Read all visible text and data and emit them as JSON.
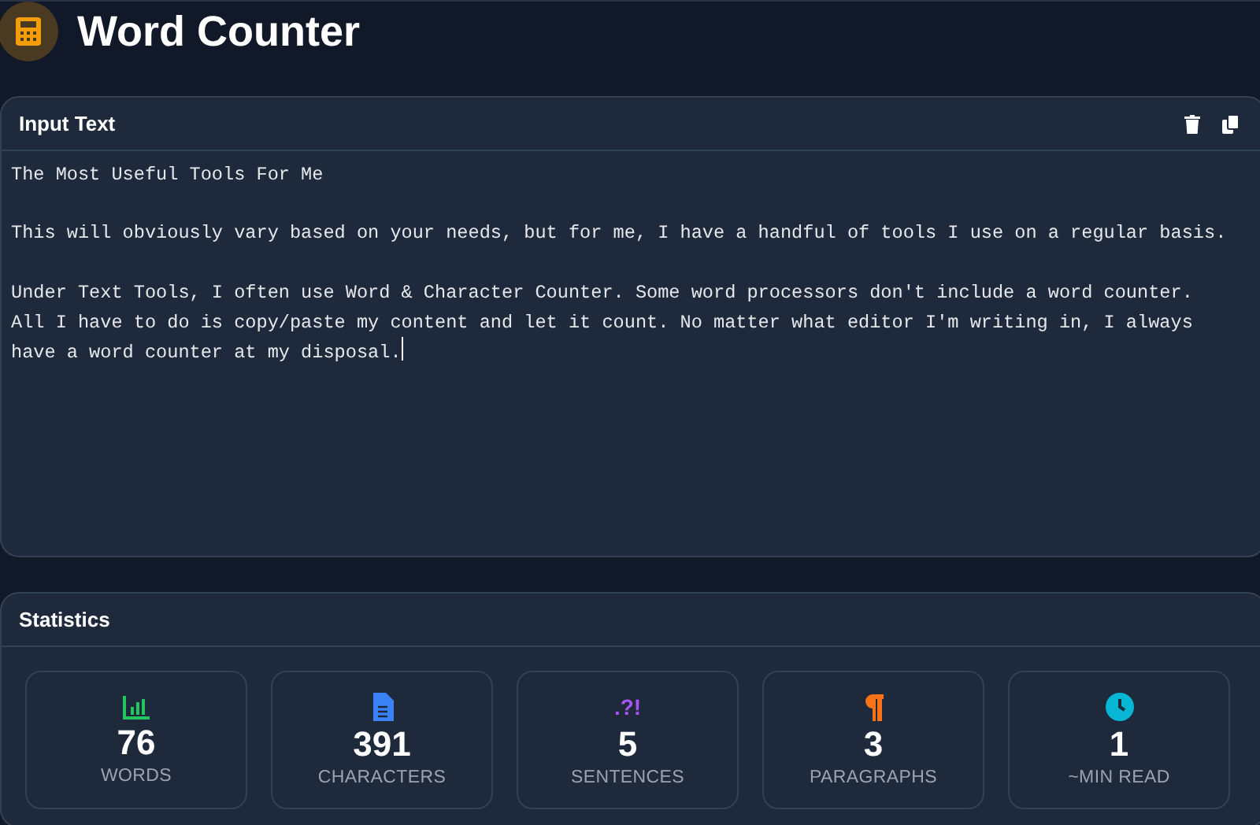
{
  "header": {
    "title": "Word Counter"
  },
  "input_panel": {
    "title": "Input Text",
    "text": "The Most Useful Tools For Me\n\nThis will obviously vary based on your needs, but for me, I have a handful of tools I use on a regular basis.\n\nUnder Text Tools, I often use Word & Character Counter. Some word processors don't include a word counter.\nAll I have to do is copy/paste my content and let it count. No matter what editor I'm writing in, I always\nhave a word counter at my disposal."
  },
  "statistics": {
    "title": "Statistics",
    "items": [
      {
        "kind": "chart",
        "color": "#22c55e",
        "value": "76",
        "label": "WORDS"
      },
      {
        "kind": "document",
        "color": "#3b82f6",
        "value": "391",
        "label": "CHARACTERS"
      },
      {
        "kind": "glyph",
        "glyph": ".?!",
        "color": "#a855f7",
        "value": "5",
        "label": "SENTENCES"
      },
      {
        "kind": "paragraph",
        "color": "#f97316",
        "value": "3",
        "label": "PARAGRAPHS"
      },
      {
        "kind": "clock",
        "color": "#06b6d4",
        "value": "1",
        "label": "~MIN READ"
      }
    ]
  }
}
